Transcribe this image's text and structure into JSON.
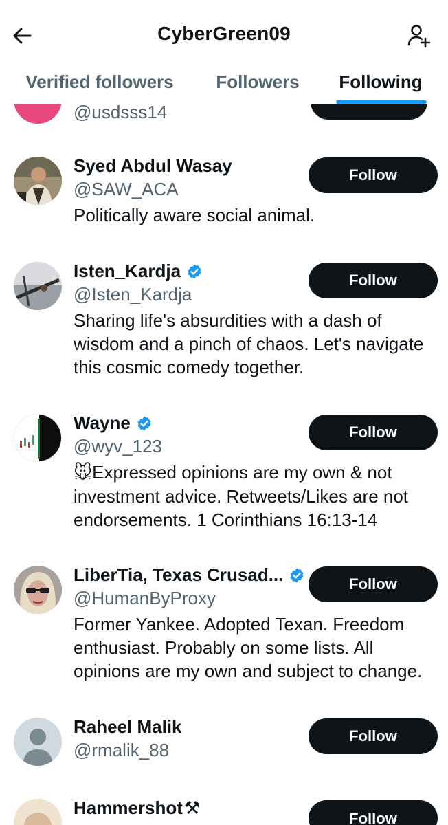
{
  "header": {
    "title": "CyberGreen09"
  },
  "tabs": [
    {
      "label": "Verified followers",
      "active": false
    },
    {
      "label": "Followers",
      "active": false
    },
    {
      "label": "Following",
      "active": true
    }
  ],
  "accent_color": "#1d9bf0",
  "users": [
    {
      "name": "",
      "handle": "@usdsss14",
      "verified": false,
      "bio": "",
      "follow_label": "",
      "avatar_icon": "pink-avatar"
    },
    {
      "name": "Syed Abdul Wasay",
      "handle": "@SAW_ACA",
      "verified": false,
      "bio": "Politically aware social animal.",
      "follow_label": "Follow",
      "avatar_icon": "photo-avatar"
    },
    {
      "name": "Isten_Kardja",
      "handle": "@Isten_Kardja",
      "verified": true,
      "bio": "Sharing life's absurdities with a dash of wisdom and a pinch of chaos. Let's navigate this cosmic comedy together.",
      "follow_label": "Follow",
      "avatar_icon": "sword-avatar"
    },
    {
      "name": "Wayne",
      "handle": "@wyv_123",
      "verified": true,
      "bio_emoji": "🐭",
      "bio": "Expressed opinions are my own & not investment advice. Retweets/Likes are not endorsements. 1 Corinthians 16:13-14",
      "follow_label": "Follow",
      "avatar_icon": "chart-avatar"
    },
    {
      "name": "LiberTia, Texas Crusad...",
      "handle": "@HumanByProxy",
      "verified": true,
      "bio": "Former Yankee. Adopted Texan. Freedom enthusiast. Probably on some lists. All opinions are my own and subject to change.",
      "follow_label": "Follow",
      "avatar_icon": "woman-avatar"
    },
    {
      "name": "Raheel Malik",
      "handle": "@rmalik_88",
      "verified": false,
      "bio": "",
      "follow_label": "Follow",
      "avatar_icon": "default-avatar"
    },
    {
      "name": "Hammershot",
      "name_emoji": "⚒",
      "handle": "",
      "verified": false,
      "bio": "",
      "follow_label": "Follow",
      "avatar_icon": "partial-avatar"
    }
  ]
}
